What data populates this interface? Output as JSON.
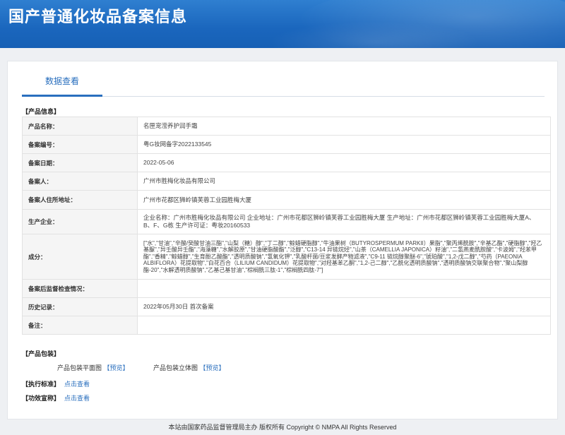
{
  "header": {
    "title": "国产普通化妆品备案信息"
  },
  "tabs": [
    {
      "label": "数据查看"
    }
  ],
  "product_info": {
    "section_label": "【产品信息】",
    "rows": [
      {
        "label": "产品名称：",
        "value": "名匣宠滢养护润手霜"
      },
      {
        "label": "备案编号：",
        "value": "粤G妆网备字2022133545"
      },
      {
        "label": "备案日期：",
        "value": "2022-05-06"
      },
      {
        "label": "备案人：",
        "value": "广州市胜梅化妆品有限公司"
      },
      {
        "label": "备案人住所地址：",
        "value": "广州市花都区狮岭镇芙蓉工业园胜梅大厦"
      },
      {
        "label": "生产企业：",
        "value": "企业名称：广州市胜梅化妆品有限公司 企业地址：广州市花都区狮岭镇芙蓉工业园胜梅大厦 生产地址：广州市花都区狮岭镇芙蓉工业园胜梅大厦A、B、F、G栋 生产许可证：粤妆20160533"
      },
      {
        "label": "成分：",
        "value": "[\"水\",\"甘油\",\"辛酸/癸酸甘油三酯\",\"山梨（糖）醇\",\"丁二醇\",\"鲸蜡硬脂醇\",\"牛油果树（BUTYROSPERMUM PARKII）果脂\",\"聚丙烯酰胺\",\"辛基乙酯\",\"硬脂醇\",\"羟乙基脲\",\"异壬酸异壬酯\",\"海藻糖\",\"水解胶原\",\"甘油硬脂酸酯\",\"泛醇\",\"C13-14 异链烷烃\",\"山茶（CAMELLIA JAPONICA）籽油\",\"二氢燕麦酰胺酸\",\"卡波姆\",\"羟苯甲酯\",\"香精\",\"鲸蜡醇\",\"生育酚乙酸酯\",\"透明质酸钠\",\"氢氧化钾\",\"乳酸杆菌/豆浆发酵产物滤液\",\"C9-11 链烷醇聚醚-6\",\"琥珀酸\",\"1,2-戊二醇\",\"芍药（PAEONIA ALBIFLORA）花提取物\",\"白花百合（LILIUM CANDIDUM）花提取物\",\"对羟基苯乙酮\",\"1,2-己二醇\",\"乙酰化透明质酸钠\",\"透明质酸钠交联聚合物\",\"聚山梨醇酯-20\",\"水解透明质酸钠\",\"乙基己基甘油\",\"棕榈酰三肽-1\",\"棕榈酰四肽-7\"]"
      },
      {
        "label": "备案后监督检查情况：",
        "value": ""
      },
      {
        "label": "历史记录：",
        "value": "2022年05月30日 首次备案"
      },
      {
        "label": "备注：",
        "value": ""
      }
    ]
  },
  "packaging": {
    "section_label": "【产品包装】",
    "flat": {
      "label": "产品包装平面图",
      "link": "【预览】"
    },
    "solid": {
      "label": "产品包装立体图",
      "link": "【预览】"
    }
  },
  "standard": {
    "label": "【执行标准】",
    "link": "点击查看"
  },
  "efficacy": {
    "label": "【功效宣称】",
    "link": "点击查看"
  },
  "footer": {
    "text": "本站由国家药品监督管理局主办 版权所有 Copyright © NMPA All Rights Reserved"
  },
  "colors": {
    "header_blue": "#1a66bd",
    "link_blue": "#2a6fbe"
  }
}
